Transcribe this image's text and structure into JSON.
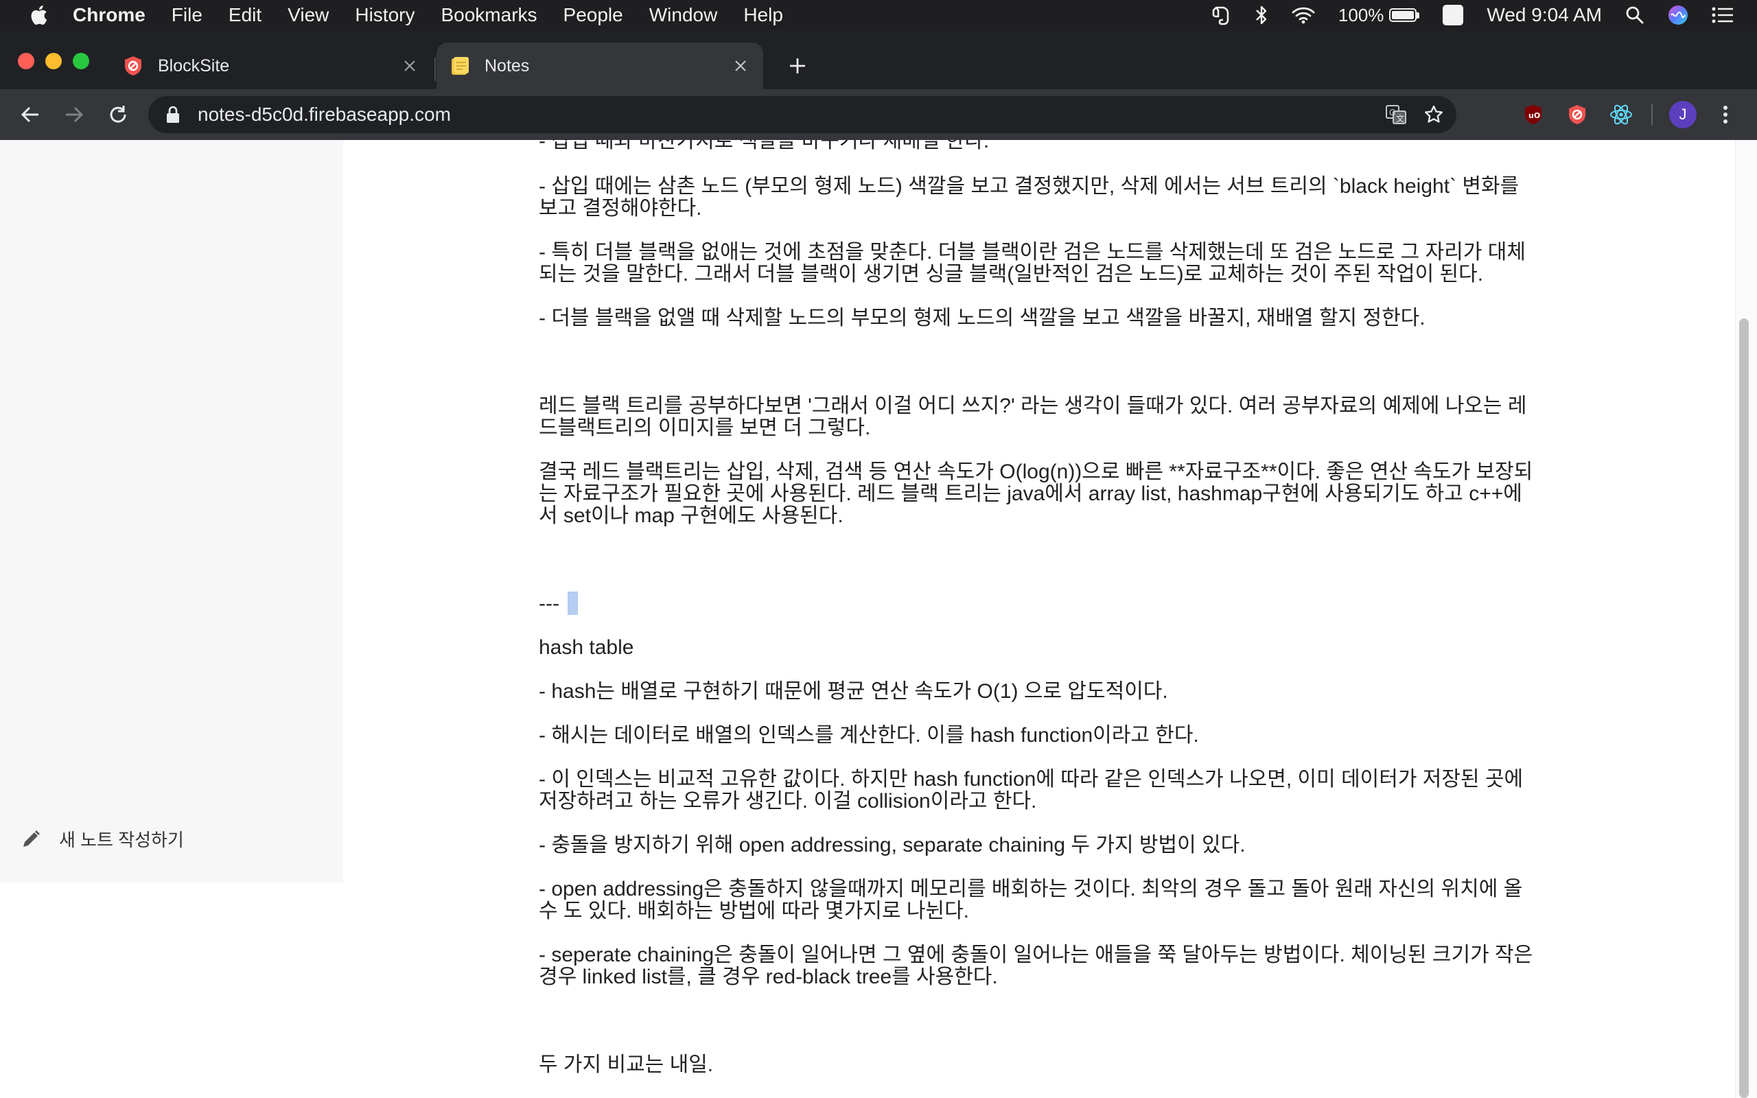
{
  "menubar": {
    "app": "Chrome",
    "items": [
      "File",
      "Edit",
      "View",
      "History",
      "Bookmarks",
      "People",
      "Window",
      "Help"
    ],
    "battery": "100%",
    "input_source": "A",
    "clock": "Wed 9:04 AM"
  },
  "tabs": [
    {
      "title": "BlockSite",
      "icon": "blocksite-shield-icon"
    },
    {
      "title": "Notes",
      "icon": "notes-icon",
      "active": true
    }
  ],
  "toolbar": {
    "url": "notes-d5c0d.firebaseapp.com",
    "profile_initial": "J"
  },
  "sidebar": {
    "new_note_label": "새 노트 작성하기"
  },
  "note": {
    "lines": [
      "- 삽입 때와 마찬가지로 색깔을 바꾸거나 재배열 한다.",
      "- 삽입 때에는 삼촌 노드 (부모의 형제 노드) 색깔을 보고 결정했지만, 삭제 에서는 서브 트리의 `black height` 변화를 보고 결정해야한다.",
      "- 특히 더블 블랙을 없애는 것에 초점을 맞춘다. 더블 블랙이란 검은 노드를 삭제했는데 또 검은 노드로 그 자리가 대체되는 것을 말한다. 그래서 더블 블랙이 생기면 싱글 블랙(일반적인 검은 노드)로 교체하는 것이 주된 작업이 된다.",
      "- 더블 블랙을 없앨 때 삭제할 노드의 부모의 형제 노드의 색깔을 보고 색깔을 바꿀지, 재배열 할지 정한다.",
      "레드 블랙 트리를 공부하다보면 '그래서 이걸 어디 쓰지?' 라는 생각이 들때가 있다. 여러 공부자료의 예제에 나오는 레드블랙트리의 이미지를 보면 더 그렇다.",
      "결국 레드 블랙트리는 삽입, 삭제, 검색 등 연산 속도가 O(log(n))으로 빠른 **자료구조**이다. 좋은 연산 속도가 보장되는 자료구조가 필요한 곳에 사용된다. 레드 블랙 트리는 java에서 array list, hashmap구현에 사용되기도 하고 c++에서 set이나 map 구현에도 사용된다.",
      "---",
      "hash table",
      "- hash는 배열로 구현하기 때문에 평균 연산 속도가 O(1) 으로 압도적이다.",
      "- 해시는 데이터로 배열의 인덱스를 계산한다. 이를 hash function이라고 한다.",
      "- 이 인덱스는 비교적 고유한 값이다. 하지만 hash function에 따라 같은 인덱스가 나오면, 이미 데이터가 저장된 곳에 저장하려고 하는 오류가 생긴다. 이걸 collision이라고 한다.",
      "- 충돌을 방지하기 위해 open addressing, separate chaining 두 가지 방법이 있다.",
      "- open addressing은 충돌하지 않을때까지 메모리를 배회하는 것이다. 최악의 경우 돌고 돌아 원래 자신의 위치에 올 수 도 있다. 배회하는 방법에 따라 몇가지로 나뉜다.",
      "- seperate chaining은 충돌이 일어나면 그 옆에 충돌이 일어나는 애들을 쭉 달아두는 방법이다. 체이닝된 크기가 작은 경우 linked list를, 클 경우 red-black tree를 사용한다.",
      "두 가지 비교는 내일."
    ]
  },
  "colors": {
    "menubar_bg": "#1f1f21",
    "tabstrip_bg": "#202124",
    "toolbar_bg": "#35363a",
    "sidebar_bg": "#f7f7f7",
    "selection": "#b4cdf0"
  }
}
